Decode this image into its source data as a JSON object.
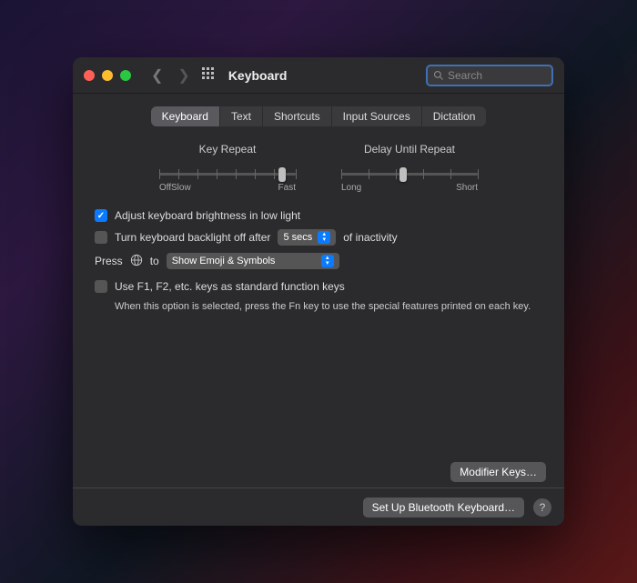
{
  "window": {
    "title": "Keyboard"
  },
  "search": {
    "placeholder": "Search"
  },
  "tabs": [
    "Keyboard",
    "Text",
    "Shortcuts",
    "Input Sources",
    "Dictation"
  ],
  "active_tab": 0,
  "sliders": {
    "key_repeat": {
      "label": "Key Repeat",
      "left": "Off",
      "left2": "Slow",
      "right": "Fast",
      "value_pct": 90
    },
    "delay": {
      "label": "Delay Until Repeat",
      "left": "Long",
      "right": "Short",
      "value_pct": 45
    }
  },
  "options": {
    "brightness": {
      "checked": true,
      "label": "Adjust keyboard brightness in low light"
    },
    "backlight": {
      "checked": false,
      "label_before": "Turn keyboard backlight off after",
      "select": "5 secs",
      "label_after": "of inactivity"
    },
    "press_globe": {
      "label_before": "Press",
      "label_mid": "to",
      "select": "Show Emoji & Symbols"
    },
    "fn_keys": {
      "checked": false,
      "label": "Use F1, F2, etc. keys as standard function keys",
      "desc": "When this option is selected, press the Fn key to use the special features printed on each key."
    }
  },
  "buttons": {
    "modifier": "Modifier Keys…",
    "bluetooth": "Set Up Bluetooth Keyboard…",
    "help": "?"
  }
}
